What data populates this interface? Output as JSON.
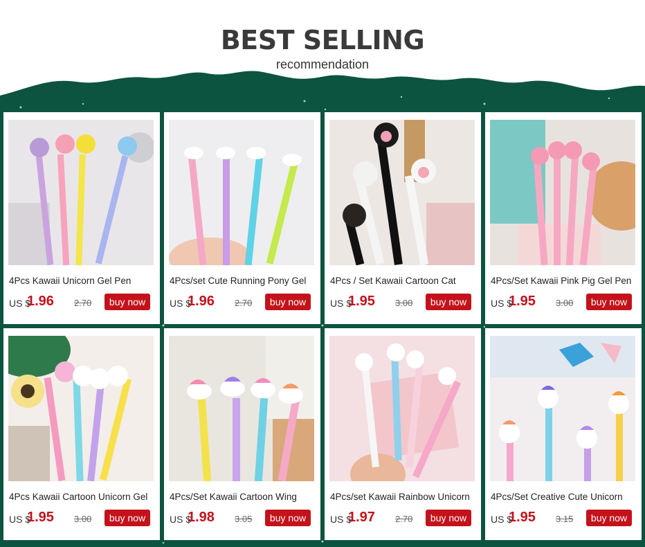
{
  "header": {
    "title": "BEST SELLING",
    "subtitle": "recommendation"
  },
  "colors": {
    "band": "#0d5440",
    "price": "#c4121b",
    "button": "#c4121b"
  },
  "products": [
    {
      "name": "4Pcs Kawaii Unicorn Gel Pen",
      "currency": "US $",
      "price": "1.96",
      "old_price": "2.70",
      "button": "buy now",
      "image": "unicorn-gel-pens-image"
    },
    {
      "name": "4Pcs/set Cute Running Pony Gel",
      "currency": "US $",
      "price": "1.96",
      "old_price": "2.70",
      "button": "buy now",
      "image": "running-pony-gel-pens-image"
    },
    {
      "name": "4Pcs / Set Kawaii Cartoon Cat",
      "currency": "US $",
      "price": "1.95",
      "old_price": "3.00",
      "button": "buy now",
      "image": "cartoon-cat-pens-image"
    },
    {
      "name": "4Pcs/Set Kawaii Pink Pig Gel Pen",
      "currency": "US $",
      "price": "1.95",
      "old_price": "3.00",
      "button": "buy now",
      "image": "pink-pig-gel-pens-image"
    },
    {
      "name": "4Pcs Kawaii Cartoon Unicorn Gel",
      "currency": "US $",
      "price": "1.95",
      "old_price": "3.00",
      "button": "buy now",
      "image": "cartoon-unicorn-gel-pens-image"
    },
    {
      "name": "4Pcs/Set Kawaii Cartoon Wing",
      "currency": "US $",
      "price": "1.98",
      "old_price": "3.05",
      "button": "buy now",
      "image": "cartoon-wing-pens-image"
    },
    {
      "name": "4Pcs/set Kawaii Rainbow Unicorn",
      "currency": "US $",
      "price": "1.97",
      "old_price": "2.70",
      "button": "buy now",
      "image": "rainbow-unicorn-pens-image"
    },
    {
      "name": "4Pcs/Set Creative Cute Unicorn",
      "currency": "US $",
      "price": "1.95",
      "old_price": "3.15",
      "button": "buy now",
      "image": "creative-unicorn-pens-image"
    }
  ]
}
